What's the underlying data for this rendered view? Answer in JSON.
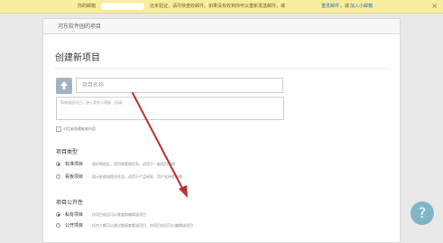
{
  "notice": {
    "prefix": "你的邮箱",
    "middle": "还未验证，请尽快查收邮件。如果没有收到你可以重新发送邮件，或",
    "resend_link": "重发邮件",
    "separator": "，或",
    "change_link": "加入小邮箱",
    "close_glyph": "×"
  },
  "breadcrumb": {
    "text": "河东软件园的项目"
  },
  "page": {
    "title": "创建新项目"
  },
  "form": {
    "name_placeholder": "项目名称",
    "desc_placeholder": "简单描述项目，便于其他人理解（选填）",
    "markdown_label": "对话者隐藏敏感内容"
  },
  "type_section": {
    "label": "项目类型",
    "options": [
      {
        "label": "标准项目",
        "desc": "面好地地区，项目和管理任务，适用于一般项目管理",
        "selected": true
      },
      {
        "label": "看板项目",
        "desc": "描示处理流程化任务，适用于产品研发、用户支持等场景",
        "selected": false
      }
    ]
  },
  "visibility_section": {
    "label": "项目公开性",
    "options": [
      {
        "label": "私有项目",
        "desc": "仅项目成员可以查看和编辑该项目",
        "selected": true
      },
      {
        "label": "公开项目",
        "desc": "任何人都可以通过链接查看该项目，仅项目成员可以编辑该项目",
        "selected": false
      }
    ]
  },
  "help": {
    "glyph": "?"
  },
  "icons": {
    "upload": "upload-icon",
    "help": "help-icon"
  },
  "colors": {
    "notice_bg": "#f6ed9e",
    "link": "#2b6fbf",
    "arrow": "#b8312f",
    "help_bg": "#7fb5c6"
  }
}
